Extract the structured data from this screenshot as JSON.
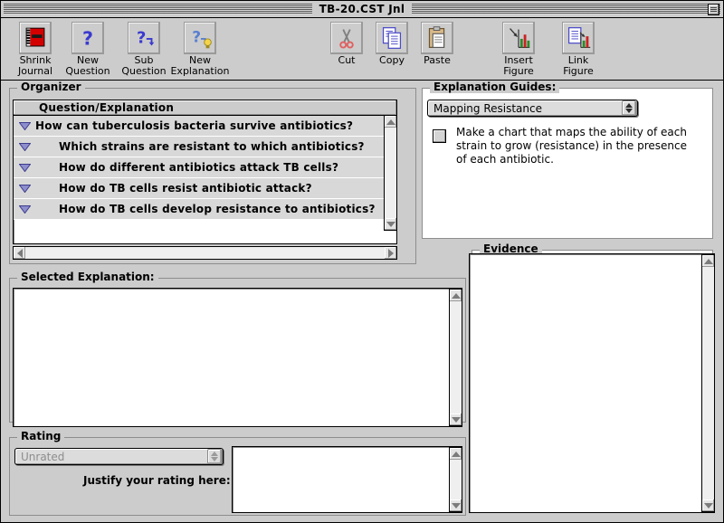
{
  "window": {
    "title": "TB-20.CST Jnl",
    "collapse_box": "collapse-box"
  },
  "toolbar": {
    "items": [
      {
        "label": "Shrink\nJournal",
        "icon": "red-notebook-icon",
        "name": "shrink-journal"
      },
      {
        "label": "New\nQuestion",
        "icon": "question-mark-icon",
        "name": "new-question"
      },
      {
        "label": "Sub\nQuestion",
        "icon": "question-mark-arrow-icon",
        "name": "sub-question"
      },
      {
        "label": "New\nExplanation",
        "icon": "question-mark-lightbulb-icon",
        "name": "new-explanation"
      },
      {
        "label": "Cut",
        "icon": "scissors-icon",
        "name": "cut"
      },
      {
        "label": "Copy",
        "icon": "documents-copy-icon",
        "name": "copy"
      },
      {
        "label": "Paste",
        "icon": "clipboard-paste-icon",
        "name": "paste"
      },
      {
        "label": "Insert\nFigure",
        "icon": "insert-chart-icon",
        "name": "insert-figure"
      },
      {
        "label": "Link\nFigure",
        "icon": "link-chart-icon",
        "name": "link-figure"
      }
    ]
  },
  "organizer": {
    "title": "Organizer",
    "column_header": "Question/Explanation",
    "rows": [
      {
        "text": "How can tuberculosis bacteria survive antibiotics?",
        "indent": 0,
        "disclosure": "collapsed-triangle"
      },
      {
        "text": "Which strains are resistant to which antibiotics?",
        "indent": 1,
        "disclosure": "collapsed-triangle"
      },
      {
        "text": "How do different antibiotics attack TB cells?",
        "indent": 1,
        "disclosure": "collapsed-triangle"
      },
      {
        "text": "How do TB cells resist antibiotic attack?",
        "indent": 1,
        "disclosure": "collapsed-triangle"
      },
      {
        "text": "How do TB cells develop resistance to antibiotics?",
        "indent": 1,
        "disclosure": "collapsed-triangle"
      }
    ]
  },
  "explanation_guides": {
    "title": "Explanation Guides:",
    "selected_guide": "Mapping Resistance",
    "guide_options": [
      "Mapping Resistance"
    ],
    "checklist": [
      {
        "checked": false,
        "text": "Make a chart that maps the ability of each strain to grow (resistance) in the presence of each antibiotic."
      }
    ]
  },
  "evidence": {
    "title": "Evidence",
    "content": ""
  },
  "selected_explanation": {
    "title": "Selected Explanation:",
    "content": ""
  },
  "rating": {
    "title": "Rating",
    "value": "Unrated",
    "options": [
      "Unrated"
    ],
    "justify_label": "Justify your rating here:",
    "justification": ""
  },
  "colors": {
    "window_bg": "#cccccc",
    "field_bg": "#ffffff",
    "row_bg": "#d8d8d8",
    "accent_triangle": "#6a6ac0",
    "notebook_red": "#d40000",
    "icon_blue": "#3a3ad0"
  }
}
